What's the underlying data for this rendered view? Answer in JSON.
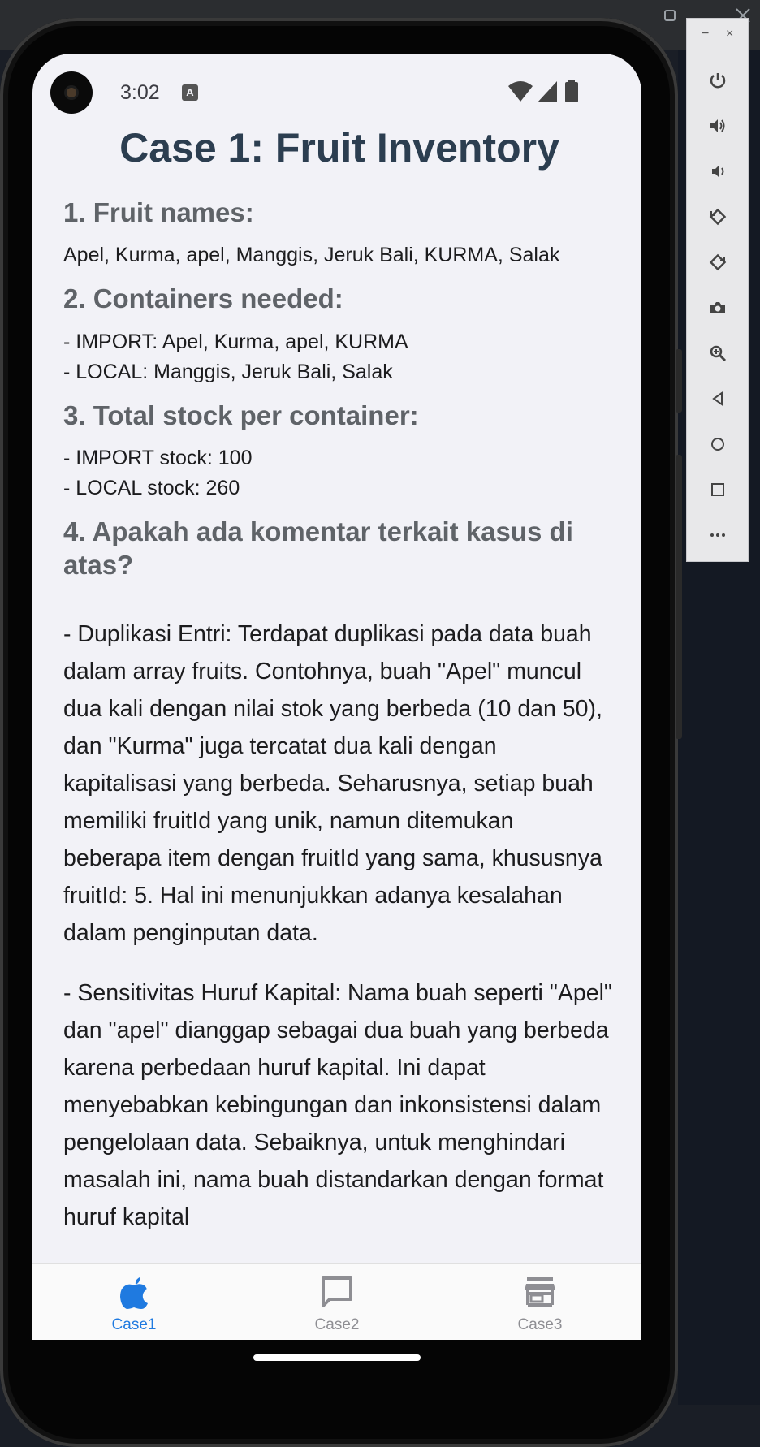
{
  "status_bar": {
    "time": "3:02",
    "notification_icon": "A"
  },
  "page": {
    "title": "Case 1: Fruit Inventory",
    "sections": [
      {
        "heading": "1. Fruit names:",
        "lines": [
          "Apel, Kurma, apel, Manggis, Jeruk Bali, KURMA, Salak"
        ]
      },
      {
        "heading": "2. Containers needed:",
        "lines": [
          "- IMPORT: Apel, Kurma, apel, KURMA",
          "- LOCAL: Manggis, Jeruk Bali, Salak"
        ]
      },
      {
        "heading": "3. Total stock per container:",
        "lines": [
          "- IMPORT stock: 100",
          "- LOCAL stock: 260"
        ]
      },
      {
        "heading": "4. Apakah ada komentar terkait kasus di atas?"
      }
    ],
    "comment_1": "- Duplikasi Entri: Terdapat duplikasi pada data buah dalam array fruits. Contohnya, buah \"Apel\" muncul dua kali dengan nilai stok yang berbeda (10 dan 50), dan \"Kurma\" juga tercatat dua kali dengan kapitalisasi yang berbeda. Seharusnya, setiap buah memiliki fruitId yang unik, namun ditemukan beberapa item dengan fruitId yang sama, khususnya fruitId: 5. Hal ini menunjukkan adanya kesalahan dalam penginputan data.",
    "comment_2": "- Sensitivitas Huruf Kapital: Nama buah seperti \"Apel\" dan \"apel\" dianggap sebagai dua buah yang berbeda karena perbedaan huruf kapital. Ini dapat menyebabkan kebingungan dan inkonsistensi dalam pengelolaan data. Sebaiknya, untuk menghindari masalah ini, nama buah distandarkan dengan format huruf kapital"
  },
  "tabs": [
    {
      "label": "Case1",
      "icon": "apple-icon",
      "active": true
    },
    {
      "label": "Case2",
      "icon": "chat-bubble-icon",
      "active": false
    },
    {
      "label": "Case3",
      "icon": "storefront-icon",
      "active": false
    }
  ],
  "colors": {
    "active_tab": "#1f7ae0",
    "inactive_tab": "#8e8e93",
    "title": "#2c3e50",
    "heading": "#5f6368"
  },
  "emulator_panel": {
    "buttons": [
      "power-icon",
      "volume-up-icon",
      "volume-down-icon",
      "rotate-left-icon",
      "rotate-right-icon",
      "camera-icon",
      "zoom-icon",
      "back-icon",
      "home-icon",
      "overview-icon",
      "more-icon"
    ],
    "minimize": "−",
    "close": "×"
  }
}
